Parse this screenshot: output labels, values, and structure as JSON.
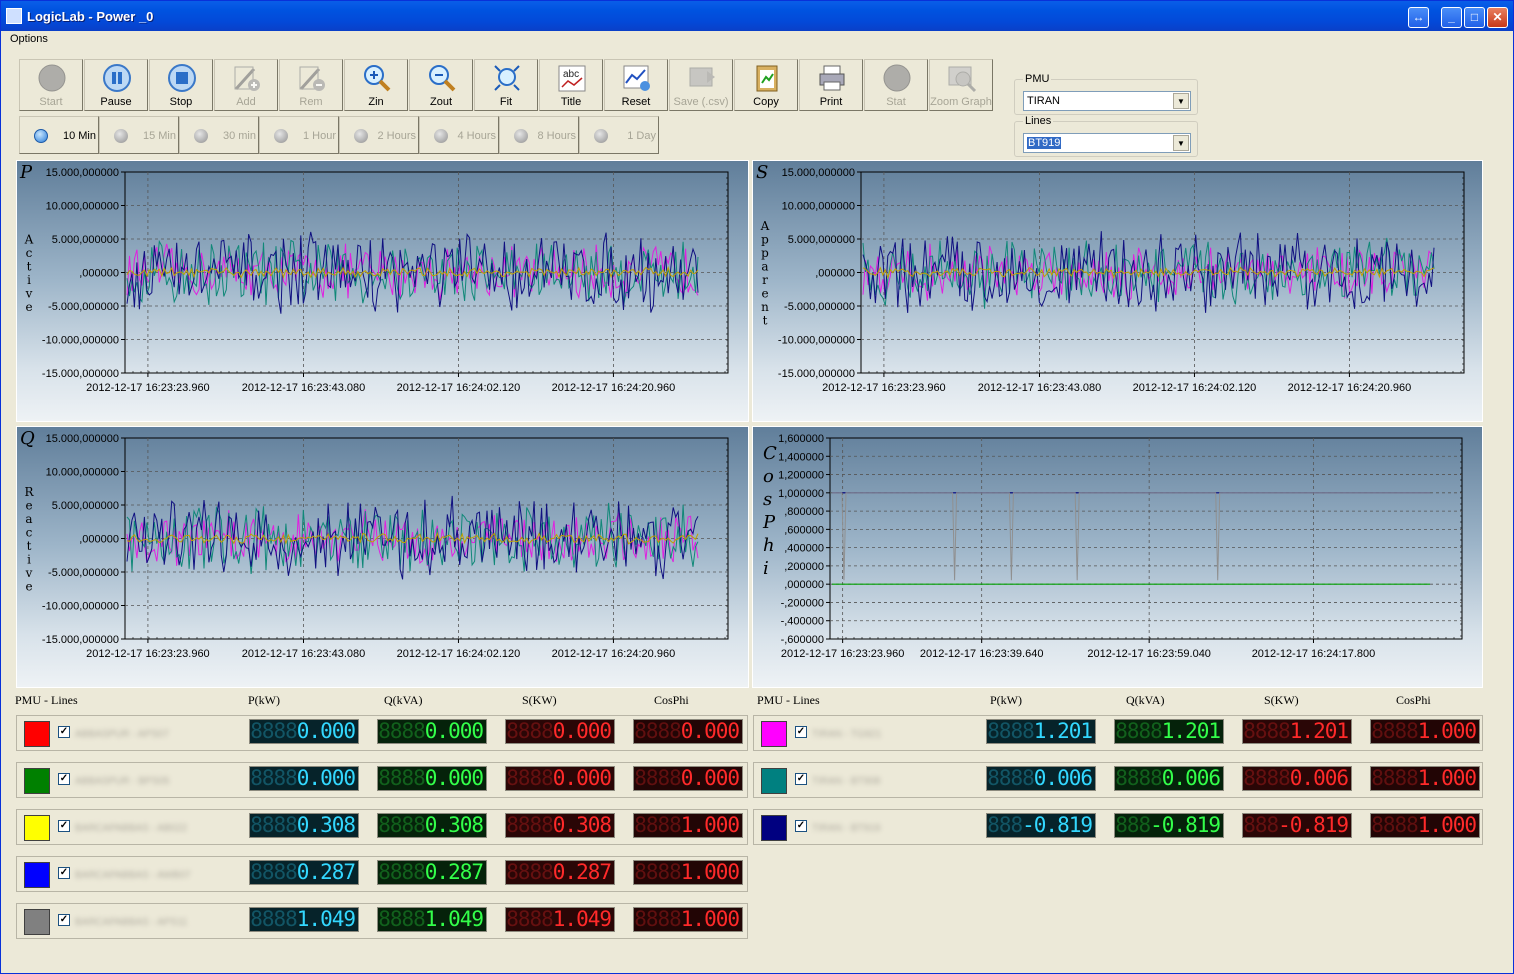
{
  "window": {
    "title": "LogicLab -  Power _0"
  },
  "menu": {
    "options": "Options"
  },
  "toolbar": [
    {
      "label": "Start",
      "icon": "start-circle-icon",
      "enabled": false
    },
    {
      "label": "Pause",
      "icon": "pause-icon",
      "enabled": true
    },
    {
      "label": "Stop",
      "icon": "stop-icon",
      "enabled": true
    },
    {
      "label": "Add",
      "icon": "add-graph-icon",
      "enabled": false
    },
    {
      "label": "Rem",
      "icon": "remove-graph-icon",
      "enabled": false
    },
    {
      "label": "Zin",
      "icon": "zoom-in-icon",
      "enabled": true
    },
    {
      "label": "Zout",
      "icon": "zoom-out-icon",
      "enabled": true
    },
    {
      "label": "Fit",
      "icon": "fit-icon",
      "enabled": true
    },
    {
      "label": "Title",
      "icon": "title-abc-icon",
      "enabled": true
    },
    {
      "label": "Reset",
      "icon": "reset-chart-icon",
      "enabled": true
    },
    {
      "label": "Save (.csv)",
      "icon": "save-csv-icon",
      "enabled": false
    },
    {
      "label": "Copy",
      "icon": "copy-clipboard-icon",
      "enabled": true
    },
    {
      "label": "Print",
      "icon": "printer-icon",
      "enabled": true
    },
    {
      "label": "Stat",
      "icon": "stat-circle-icon",
      "enabled": false
    },
    {
      "label": "Zoom Graph",
      "icon": "zoom-graph-icon",
      "enabled": false
    }
  ],
  "ranges": [
    {
      "label": "10 Min",
      "active": true
    },
    {
      "label": "15 Min",
      "active": false
    },
    {
      "label": "30 min",
      "active": false
    },
    {
      "label": "1 Hour",
      "active": false
    },
    {
      "label": "2 Hours",
      "active": false
    },
    {
      "label": "4 Hours",
      "active": false
    },
    {
      "label": "8 Hours",
      "active": false
    },
    {
      "label": "1 Day",
      "active": false
    }
  ],
  "pmu": {
    "label": "PMU",
    "value": "TIRAN"
  },
  "lines": {
    "label": "Lines",
    "value": "BT919"
  },
  "colors": {
    "magenta": "#e020e0",
    "teal": "#108878",
    "navy": "#101080",
    "line_red": "#ff0000",
    "line_green": "#008000",
    "line_yellow": "#ffff00",
    "line_blue": "#0000ff",
    "line_gray": "#808080",
    "line_magenta": "#ff00ff",
    "line_teal": "#008080",
    "line_navy": "#000080"
  },
  "chart_data": [
    {
      "type": "line",
      "id": "P",
      "letter": "P",
      "ylabel": "Active",
      "ylim": [
        -15000000,
        15000000
      ],
      "yticks": [
        "15.000,000000",
        "10.000,000000",
        "5.000,000000",
        ",000000",
        "-5.000,000000",
        "-10.000,000000",
        "-15.000,000000"
      ],
      "xticks": [
        "2012-12-17 16:23:23.960",
        "2012-12-17 16:23:43.080",
        "2012-12-17 16:24:02.120",
        "2012-12-17 16:24:20.960"
      ],
      "series": [
        {
          "color": "#e020e0",
          "amp": 4500000
        },
        {
          "color": "#108878",
          "amp": 5500000
        },
        {
          "color": "#101080",
          "amp": 6500000
        },
        {
          "color": "#c0a000",
          "amp": 800000
        }
      ],
      "grid": true
    },
    {
      "type": "line",
      "id": "S",
      "letter": "S",
      "ylabel": "Apparent",
      "ylim": [
        -15000000,
        15000000
      ],
      "yticks": [
        "15.000,000000",
        "10.000,000000",
        "5.000,000000",
        ",000000",
        "-5.000,000000",
        "-10.000,000000",
        "-15.000,000000"
      ],
      "xticks": [
        "2012-12-17 16:23:23.960",
        "2012-12-17 16:23:43.080",
        "2012-12-17 16:24:02.120",
        "2012-12-17 16:24:20.960"
      ],
      "series": [
        {
          "color": "#e020e0",
          "amp": 4500000
        },
        {
          "color": "#108878",
          "amp": 5500000
        },
        {
          "color": "#101080",
          "amp": 6500000
        },
        {
          "color": "#c0a000",
          "amp": 800000
        }
      ],
      "grid": true
    },
    {
      "type": "line",
      "id": "Q",
      "letter": "Q",
      "ylabel": "Reactive",
      "ylim": [
        -15000000,
        15000000
      ],
      "yticks": [
        "15.000,000000",
        "10.000,000000",
        "5.000,000000",
        ",000000",
        "-5.000,000000",
        "-10.000,000000",
        "-15.000,000000"
      ],
      "xticks": [
        "2012-12-17 16:23:23.960",
        "2012-12-17 16:23:43.080",
        "2012-12-17 16:24:02.120",
        "2012-12-17 16:24:20.960"
      ],
      "series": [
        {
          "color": "#e020e0",
          "amp": 4500000
        },
        {
          "color": "#108878",
          "amp": 5500000
        },
        {
          "color": "#101080",
          "amp": 6500000
        },
        {
          "color": "#c0a000",
          "amp": 800000
        }
      ],
      "grid": true
    },
    {
      "type": "line",
      "id": "CosPhi",
      "letter": "CosPhi",
      "ylabel": "",
      "ylim": [
        -0.6,
        1.6
      ],
      "yticks": [
        "1,600000",
        "1,400000",
        "1,200000",
        "1,000000",
        ",800000",
        ",600000",
        ",400000",
        ",200000",
        ",000000",
        "-,200000",
        "-,400000",
        "-,600000"
      ],
      "xticks": [
        "2012-12-17 16:23:23.960",
        "2012-12-17 16:23:39.640",
        "2012-12-17 16:23:59.040",
        "2012-12-17 16:24:17.800"
      ],
      "series": [
        {
          "color": "#000080",
          "value": 1.0
        },
        {
          "color": "#00a000",
          "value": 0.0
        },
        {
          "color": "#909090",
          "value": 1.0,
          "dips_at": [
            0.02,
            0.205,
            0.3,
            0.41,
            0.645
          ]
        }
      ],
      "grid": true
    }
  ],
  "table_headers": {
    "pmu_lines": "PMU - Lines",
    "p": "P(kW)",
    "q": "Q(kVA)",
    "s": "S(KW)",
    "cosphi": "CosPhi"
  },
  "left_rows": [
    {
      "color": "#ff0000",
      "checked": "✓",
      "name": "ABBASPUR - APS07",
      "p": "0.000",
      "q": "0.000",
      "s": "0.000",
      "cos": "0.000"
    },
    {
      "color": "#008000",
      "checked": "✓",
      "name": "ABBASPUR - BPS05",
      "p": "0.000",
      "q": "0.000",
      "s": "0.000",
      "cos": "0.000"
    },
    {
      "color": "#ffff00",
      "checked": "✓",
      "name": "BARCAPABBAS - AB022",
      "p": "0.308",
      "q": "0.308",
      "s": "0.308",
      "cos": "1.000"
    },
    {
      "color": "#0000ff",
      "checked": "✓",
      "name": "BARCAPABBAS - AWB07",
      "p": "0.287",
      "q": "0.287",
      "s": "0.287",
      "cos": "1.000"
    },
    {
      "color": "#808080",
      "checked": "✓",
      "name": "BARCAPABBAS - APS11",
      "p": "1.049",
      "q": "1.049",
      "s": "1.049",
      "cos": "1.000"
    }
  ],
  "right_rows": [
    {
      "color": "#ff00ff",
      "checked": "✓",
      "name": "TIRAN - TG921",
      "p": "1.201",
      "q": "1.201",
      "s": "1.201",
      "cos": "1.000"
    },
    {
      "color": "#008080",
      "checked": "✓",
      "name": "TIRAN - BT908",
      "p": "0.006",
      "q": "0.006",
      "s": "0.006",
      "cos": "1.000"
    },
    {
      "color": "#000080",
      "checked": "✓",
      "name": "TIRAN - BT919",
      "p": "-0.819",
      "q": "-0.819",
      "s": "-0.819",
      "cos": "1.000"
    }
  ]
}
